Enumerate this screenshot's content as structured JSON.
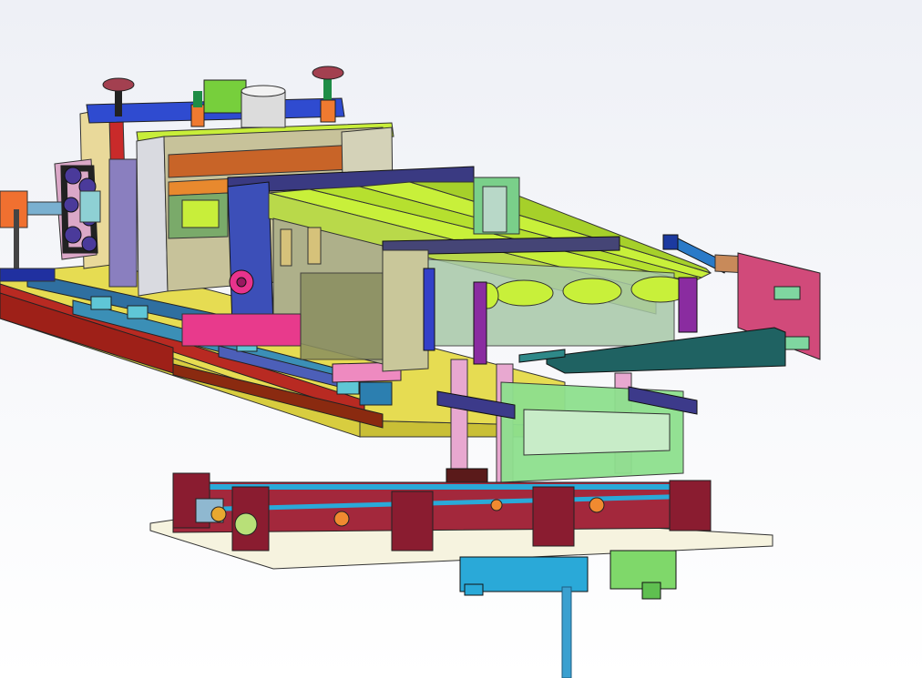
{
  "scene": {
    "type": "cad-3d-assembly-render",
    "subject": "conveyor-feeder-machine",
    "visible_text": [],
    "colors": {
      "background_top": "#eef0f6",
      "background_bottom": "#ffffff",
      "base_yellow": "#d9cf45",
      "base_red": "#b82a22",
      "belt_lime": "#c8f03a",
      "frame_khaki": "#c8c49a",
      "plate_blue": "#3c4fb8",
      "plate_pink": "#e8338c",
      "plate_maroon": "#a3283c",
      "bracket_green": "#8ee08e",
      "teal_arm": "#1f6262",
      "cyan_parts": "#2aa9d8",
      "lower_base": "#f6f3df"
    },
    "parts": [
      "main-base-frame",
      "gearbox-side-assembly",
      "roller-press-unit",
      "belt-conveyor",
      "pneumatic-cylinder",
      "support-arm",
      "lifting-bracket",
      "lower-linear-module",
      "drive-motor",
      "support-column"
    ]
  }
}
